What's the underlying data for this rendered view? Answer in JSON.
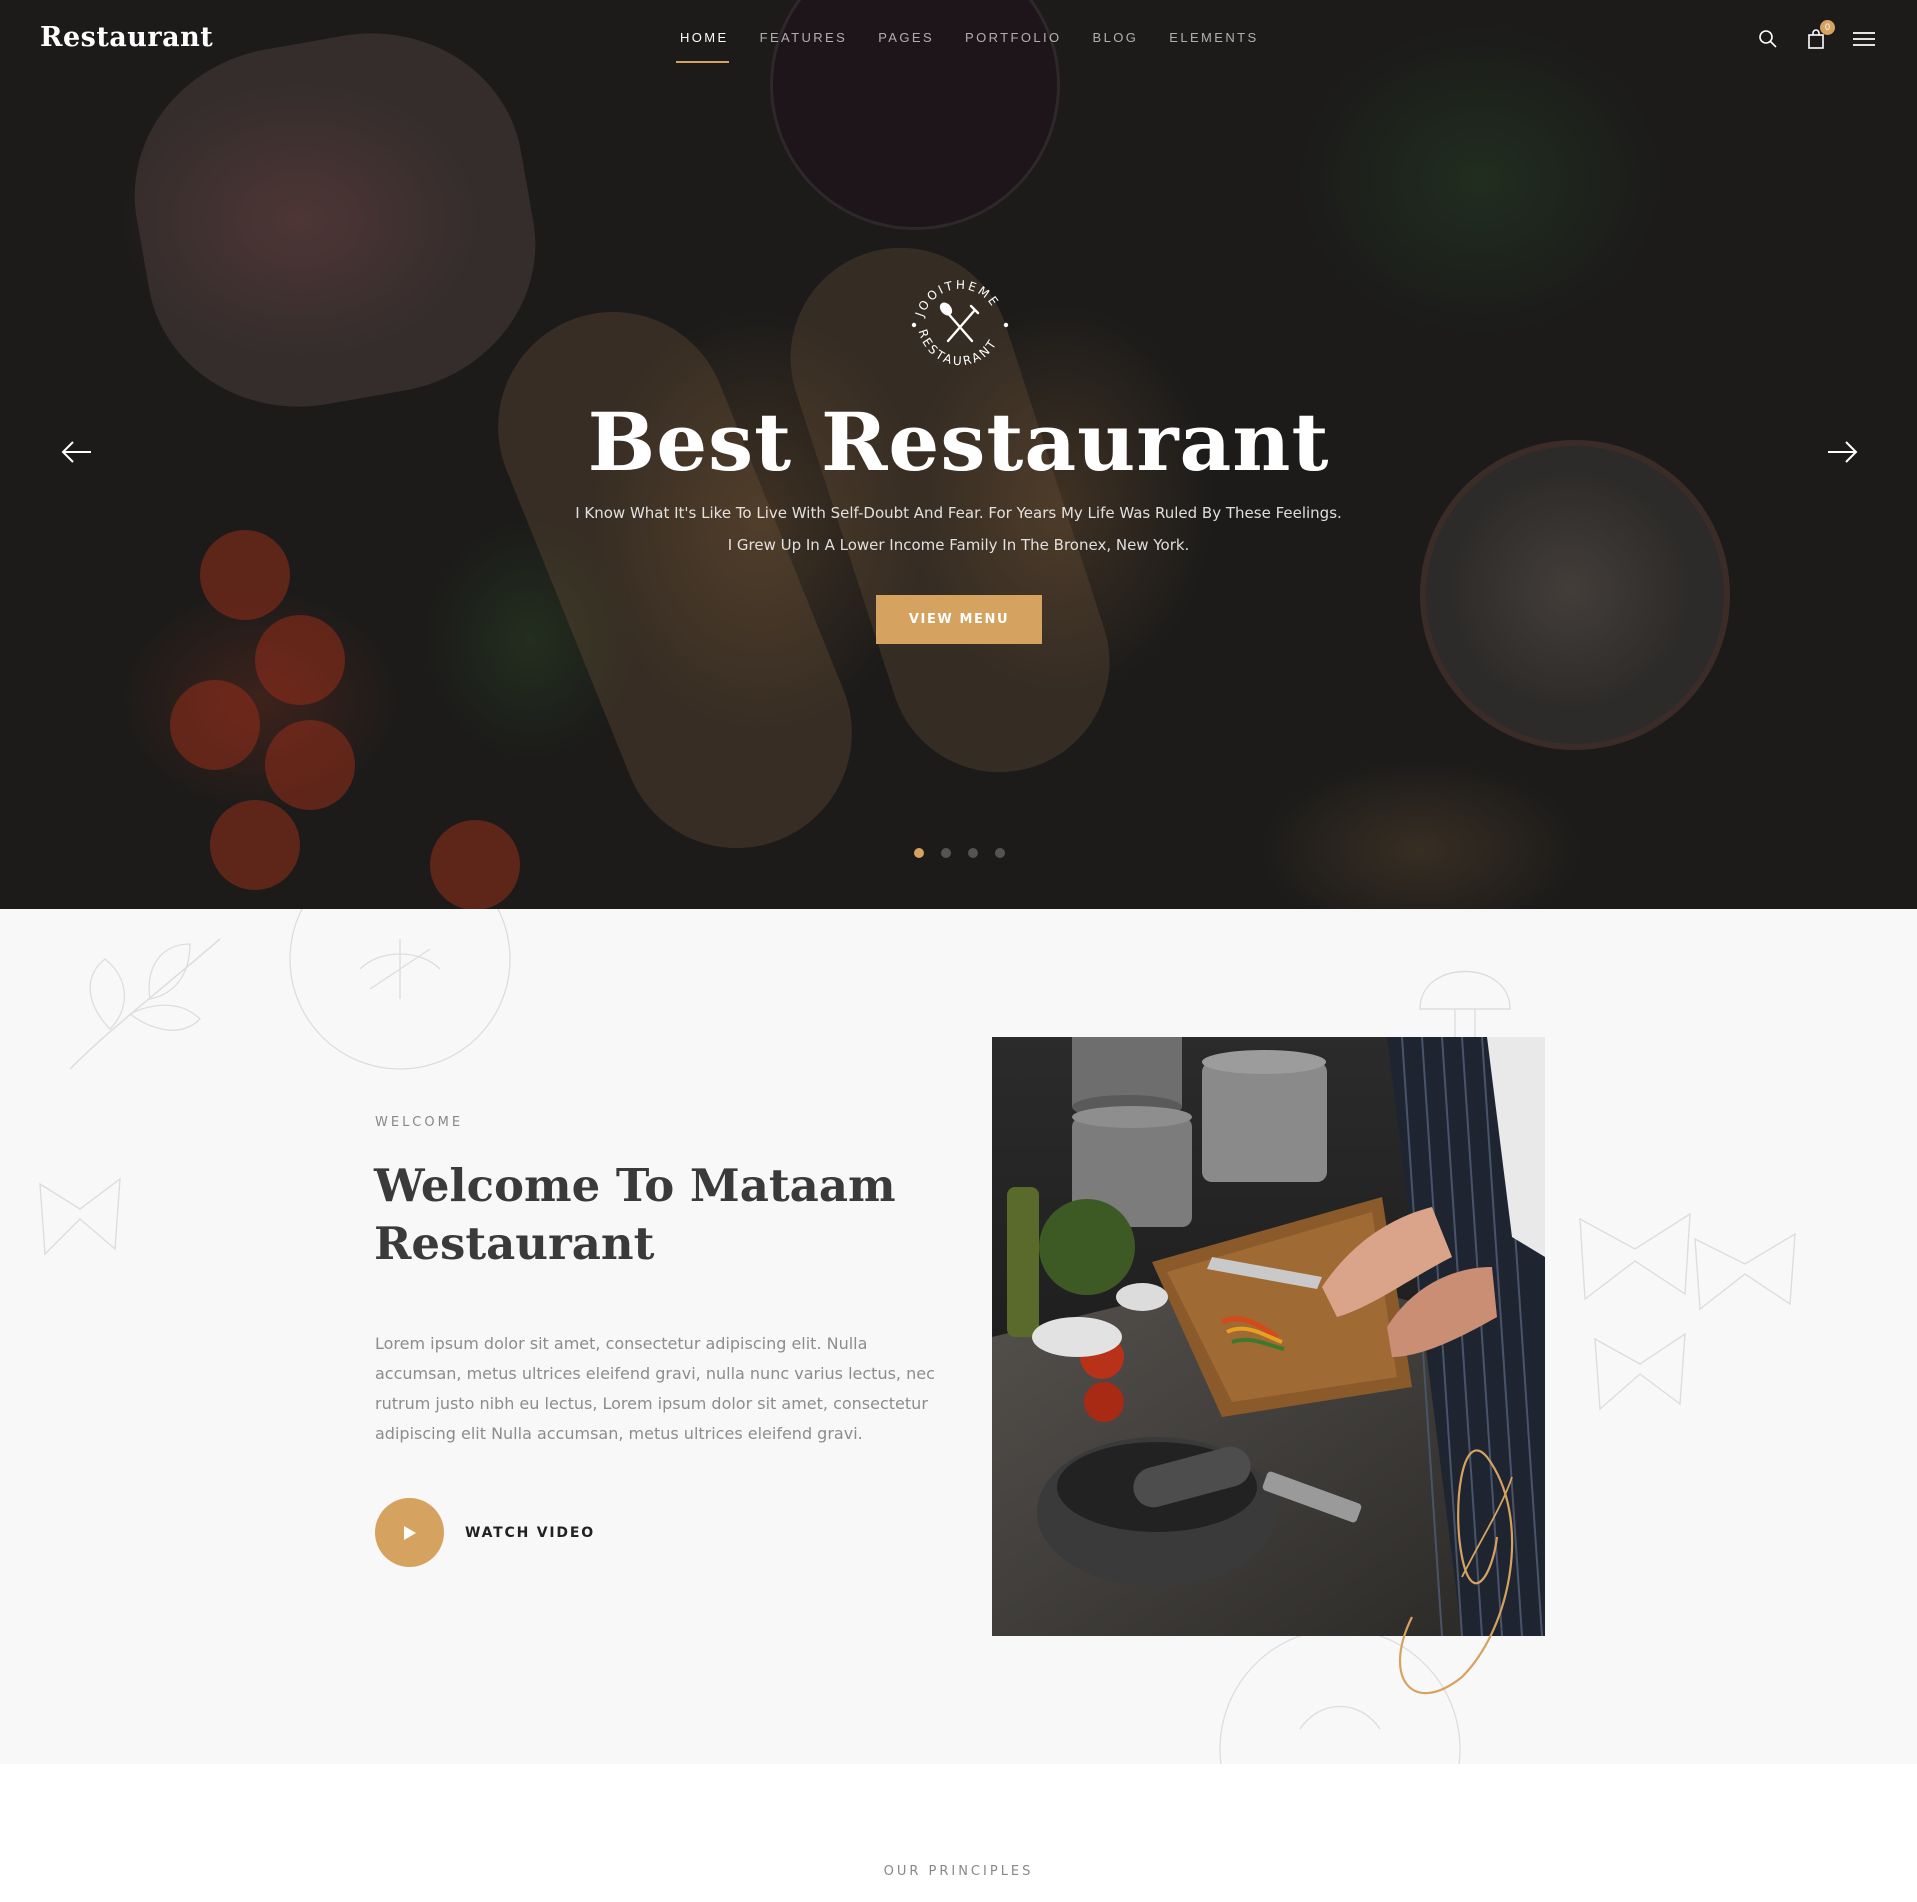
{
  "header": {
    "logo": "Restaurant",
    "nav": [
      {
        "label": "HOME",
        "active": true
      },
      {
        "label": "FEATURES",
        "active": false
      },
      {
        "label": "PAGES",
        "active": false
      },
      {
        "label": "PORTFOLIO",
        "active": false
      },
      {
        "label": "BLOG",
        "active": false
      },
      {
        "label": "ELEMENTS",
        "active": false
      }
    ],
    "icons": [
      "search-icon",
      "cart-icon",
      "menu-icon"
    ],
    "cart_count": "0"
  },
  "hero": {
    "emblem_top": "JOOITHEME",
    "emblem_bottom": "RESTAURANT",
    "title": "Best Restaurant",
    "text_line1": "I Know What It's Like To Live With Self-Doubt And Fear. For Years My Life Was Ruled By These Feelings.",
    "text_line2": "I Grew Up In A Lower Income Family In The Bronex, New York.",
    "button": "VIEW MENU",
    "slides": 4,
    "active_slide": 1
  },
  "welcome": {
    "eyebrow": "WELCOME",
    "title": "Welcome To Mataam Restaurant",
    "body": "Lorem ipsum dolor sit amet, consectetur adipiscing elit. Nulla accumsan, metus ultrices eleifend gravi, nulla nunc varius lectus, nec rutrum justo nibh eu lectus, Lorem ipsum dolor sit amet, consectetur adipiscing elit Nulla accumsan, metus ultrices eleifend gravi.",
    "video_label": "WATCH VIDEO"
  },
  "principles": {
    "eyebrow": "OUR PRINCIPLES"
  },
  "colors": {
    "accent": "#d6a260",
    "hero_bg": "#1c1b1a",
    "section_bg": "#f8f8f8",
    "heading": "#3a3a3a",
    "body_text": "#8c8c8c"
  }
}
